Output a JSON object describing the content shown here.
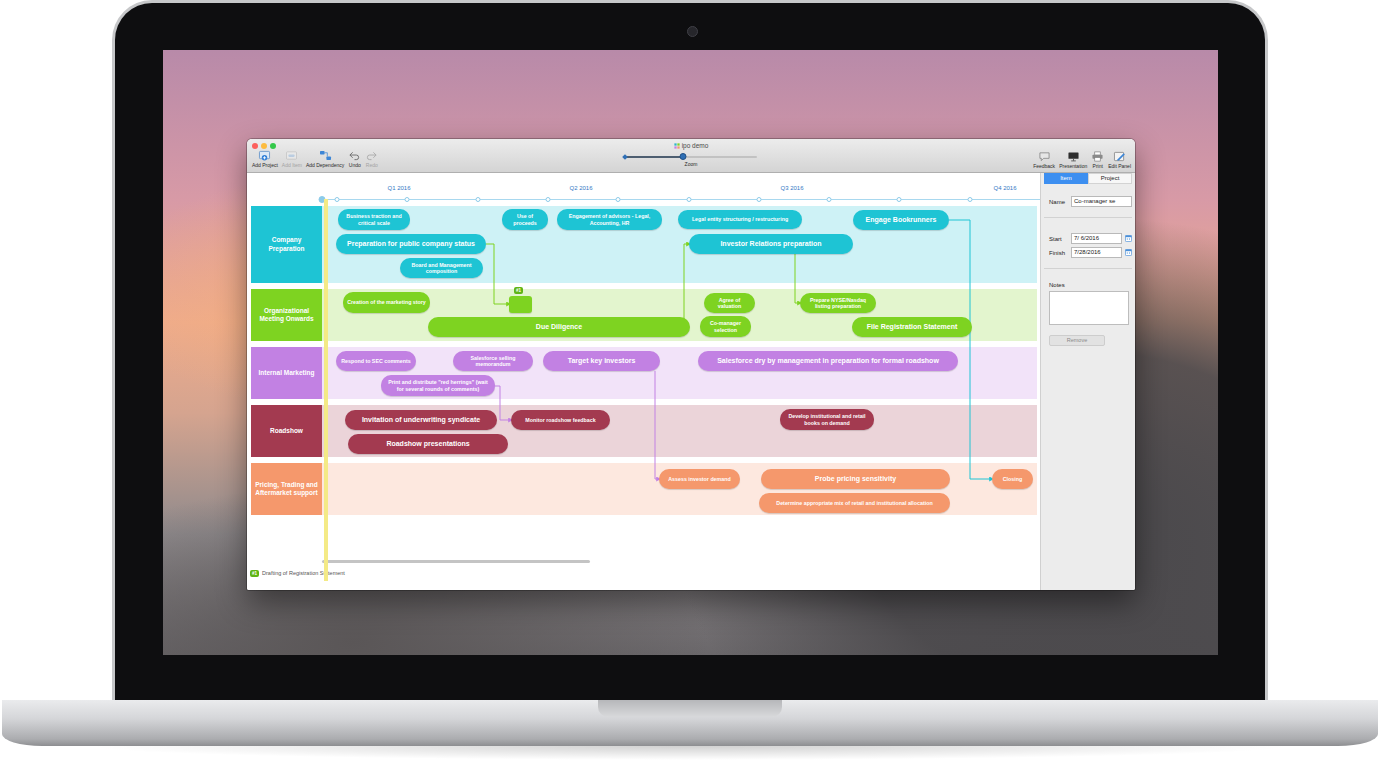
{
  "window": {
    "title": "ipo demo"
  },
  "toolbar": {
    "left": [
      {
        "label": "Add Project",
        "disabled": false
      },
      {
        "label": "Add Item",
        "disabled": true
      },
      {
        "label": "Add Dependency",
        "disabled": false
      },
      {
        "label": "Undo",
        "disabled": false
      },
      {
        "label": "Redo",
        "disabled": true
      }
    ],
    "zoom": {
      "label": "Zoom",
      "level": 0.44
    },
    "right": [
      {
        "label": "Feedback"
      },
      {
        "label": "Presentation"
      },
      {
        "label": "Print"
      },
      {
        "label": "Edit Panel"
      }
    ]
  },
  "timeline": {
    "quarters": [
      "Q1 2016",
      "Q2 2016",
      "Q3 2016",
      "Q4 2016"
    ]
  },
  "lanes": [
    {
      "name": "Company Preparation",
      "color": "#1ec4d4",
      "items": [
        {
          "label": "Business traction and critical scale",
          "kind": "minor"
        },
        {
          "label": "Use of proceeds",
          "kind": "minor"
        },
        {
          "label": "Engagement of advisors - Legal, Accounting, HR",
          "kind": "minor"
        },
        {
          "label": "Legal entity structuring / restructuring",
          "kind": "minor"
        },
        {
          "label": "Engage Bookrunners",
          "kind": "major"
        },
        {
          "label": "Preparation for public company status",
          "kind": "major"
        },
        {
          "label": "Investor Relations preparation",
          "kind": "major"
        },
        {
          "label": "Board and Management composition",
          "kind": "minor"
        }
      ]
    },
    {
      "name": "Organizational Meeting Onwards",
      "color": "#7ed321",
      "items": [
        {
          "label": "Creation of the marketing story",
          "kind": "minor"
        },
        {
          "label": "#1",
          "kind": "milestone"
        },
        {
          "label": "Agree of valuation",
          "kind": "minor"
        },
        {
          "label": "Prepare NYSE/Nasdaq listing preparation",
          "kind": "minor"
        },
        {
          "label": "Due Diligence",
          "kind": "major"
        },
        {
          "label": "Co-manager selection",
          "kind": "minor"
        },
        {
          "label": "File Registration Statement",
          "kind": "major"
        }
      ]
    },
    {
      "name": "Internal Marketing",
      "color": "#c281e3",
      "items": [
        {
          "label": "Respond to SEC comments",
          "kind": "minor"
        },
        {
          "label": "Salesforce selling memorandum",
          "kind": "minor"
        },
        {
          "label": "Target key investors",
          "kind": "major"
        },
        {
          "label": "Salesforce dry by management in preparation for formal roadshow",
          "kind": "major"
        },
        {
          "label": "Print and distribute \"red herrings\" (wait for several rounds of comments)",
          "kind": "minor"
        }
      ]
    },
    {
      "name": "Roadshow",
      "color": "#a33a50",
      "items": [
        {
          "label": "Invitation of underwriting syndicate",
          "kind": "major"
        },
        {
          "label": "Monitor roadshow feedback",
          "kind": "minor"
        },
        {
          "label": "Develop institutional and retail books on demand",
          "kind": "minor"
        },
        {
          "label": "Roadshow presentations",
          "kind": "major"
        }
      ]
    },
    {
      "name": "Pricing, Trading and Aftermarket support",
      "color": "#f5986c",
      "items": [
        {
          "label": "Assess investor demand",
          "kind": "minor"
        },
        {
          "label": "Probe pricing sensitivity",
          "kind": "major"
        },
        {
          "label": "Determine appropriate mix of retail and institutional allocation",
          "kind": "minor"
        },
        {
          "label": "Closing",
          "kind": "minor"
        }
      ]
    }
  ],
  "inspector": {
    "tabs": [
      {
        "label": "Item",
        "selected": true
      },
      {
        "label": "Project",
        "selected": false
      }
    ],
    "fields": [
      {
        "label": "Name",
        "value": "Co-manager se",
        "kind": "text"
      },
      {
        "label": "Start",
        "value": "7/ 6/2016",
        "kind": "date"
      },
      {
        "label": "Finish",
        "value": "7/28/2016",
        "kind": "date"
      }
    ],
    "notes": {
      "label": "Notes"
    },
    "button": "Remove"
  },
  "status_bar": {
    "badge": "#1",
    "text": "Drafting of Registration Statement"
  }
}
